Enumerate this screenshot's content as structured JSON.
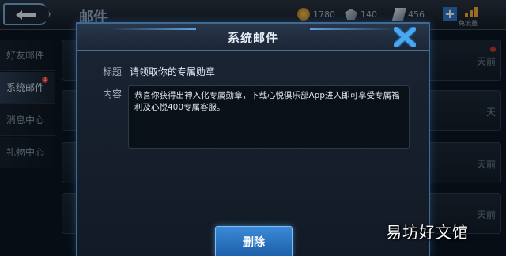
{
  "topbar": {
    "title": "邮件",
    "gold": "1780",
    "diamond": "140",
    "coupon": "456",
    "plus_label": "+",
    "network_label": "免流量"
  },
  "sidebar": {
    "items": [
      {
        "label": "好友邮件",
        "active": false
      },
      {
        "label": "系统邮件",
        "active": true,
        "badge": "1"
      },
      {
        "label": "消息中心",
        "active": false
      },
      {
        "label": "礼物中心",
        "active": false
      }
    ]
  },
  "mail_list": {
    "times": [
      "天前",
      "天",
      "天前",
      "天前"
    ]
  },
  "dialog": {
    "title": "系统邮件",
    "subject_label": "标题",
    "subject_value": "请领取你的专属勋章",
    "content_label": "内容",
    "content_value": "恭喜你获得出神入化专属勋章，下载心悦俱乐部App进入即可享受专属福利及心悦400专属客服。",
    "delete_label": "删除"
  },
  "watermark": "易坊好文馆",
  "colors": {
    "accent": "#3a8ad8",
    "badge": "#d73a2a",
    "close": "#4aa8ee"
  }
}
